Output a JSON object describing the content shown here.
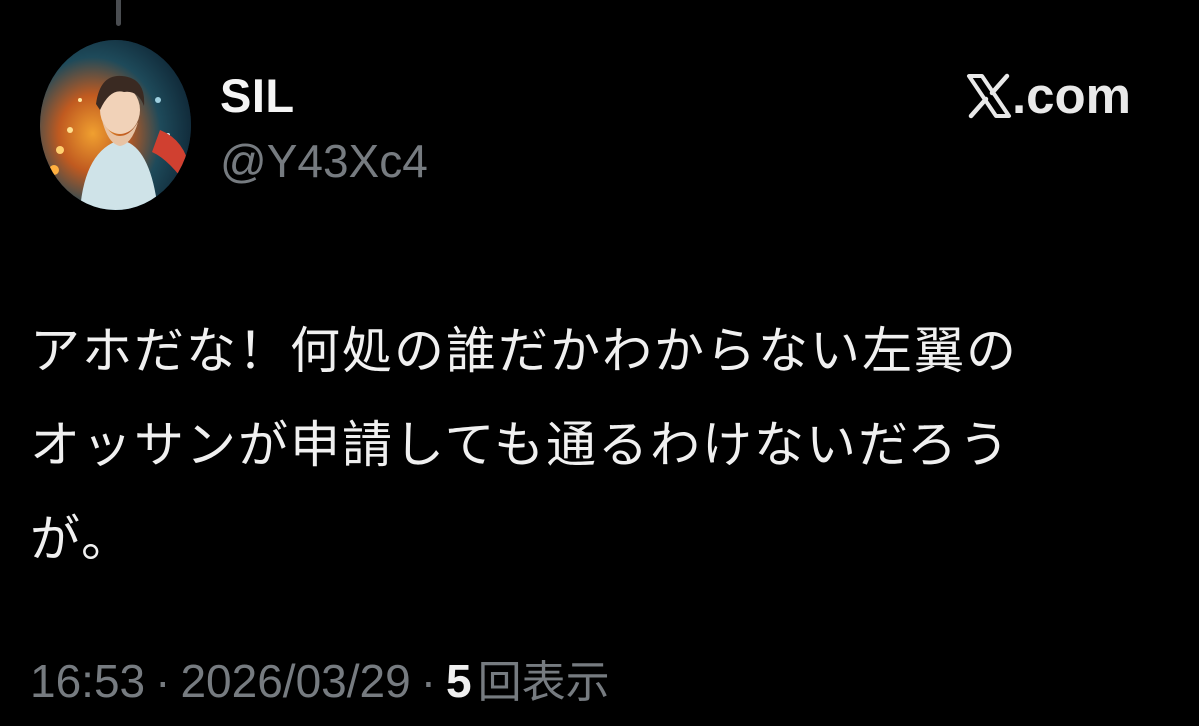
{
  "author": {
    "display_name": "SIL",
    "handle": "@Y43Xc4",
    "avatar_icon": "anime-boy-avatar"
  },
  "brand": {
    "label": ".com",
    "icon": "x-logo-icon"
  },
  "tweet": {
    "lines": [
      "アホだな！何処の誰だかわからない左翼の",
      "オッサンが申請しても通るわけないだろう",
      "が。"
    ]
  },
  "meta": {
    "time": "16:53",
    "separator": "·",
    "date": "2026/03/29",
    "views_count": "5",
    "views_label": "回表示"
  }
}
